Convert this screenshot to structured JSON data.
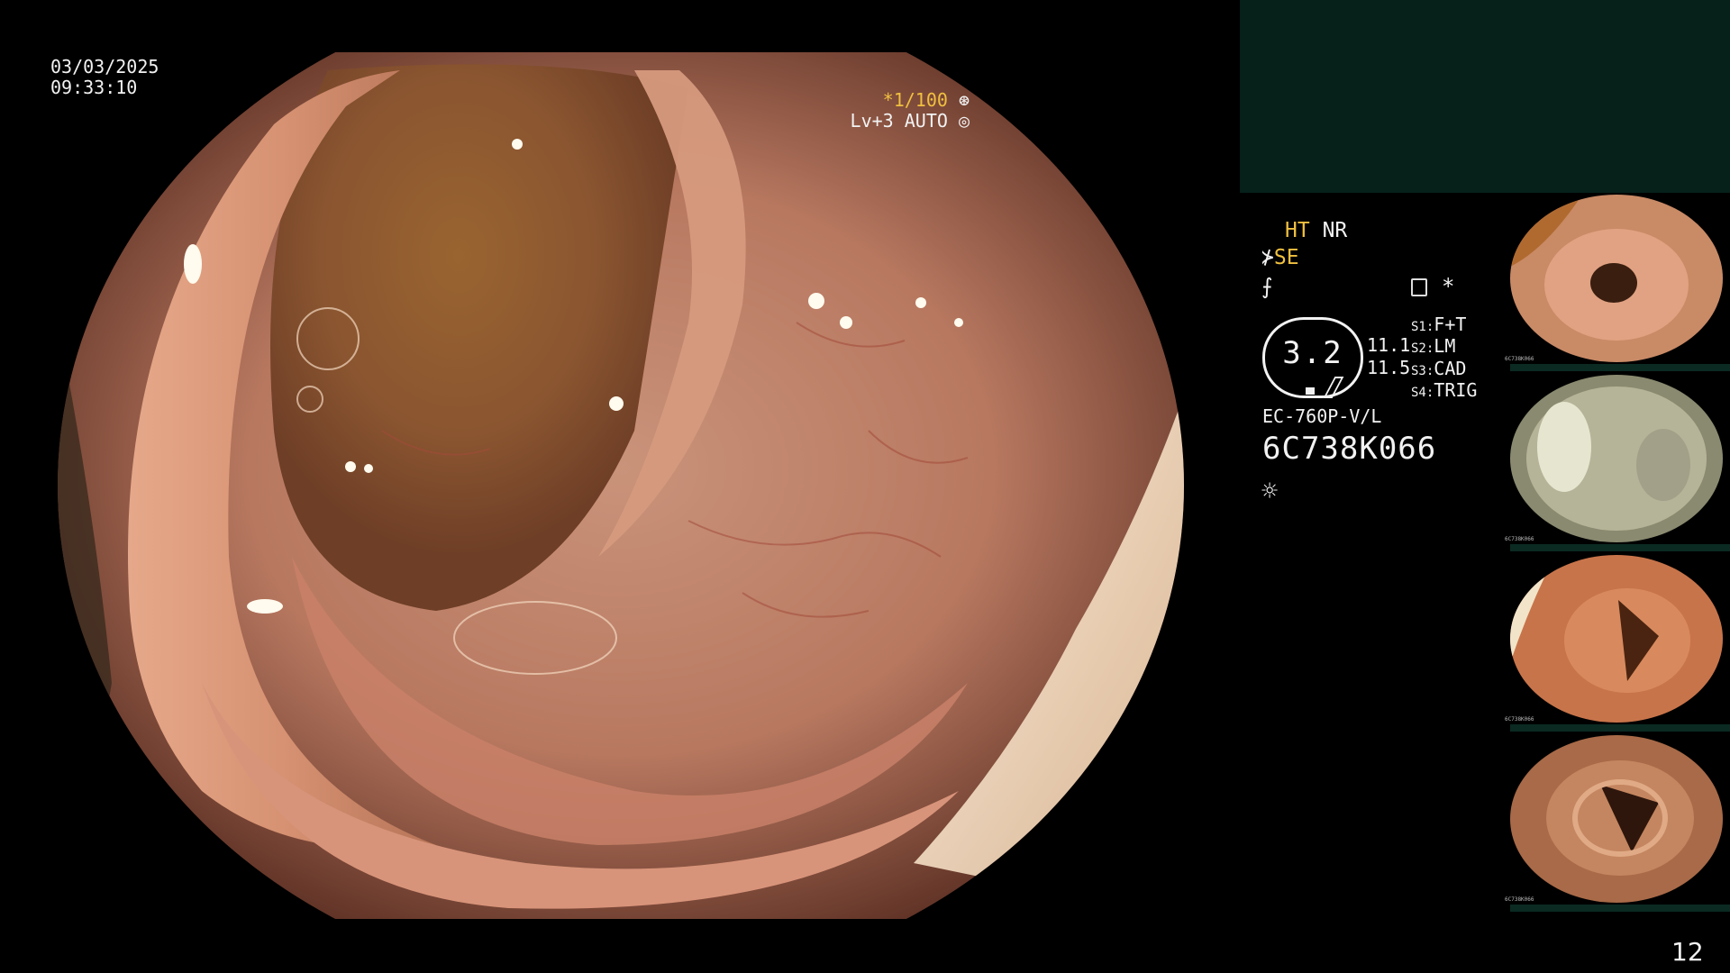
{
  "overlay": {
    "date": "03/03/2025",
    "time": "09:33:10",
    "shutter_speed": "*1/100",
    "level_mode": "Lv+3 AUTO"
  },
  "panel": {
    "mode_ht": "HT",
    "mode_nr": "NR",
    "mode_se": "SE",
    "star": "*",
    "zoom_value": "3.2",
    "zoom_top": "11.1",
    "zoom_bottom": "11.5",
    "switches": [
      {
        "key": "S1",
        "value": "F+T"
      },
      {
        "key": "S2",
        "value": "LM"
      },
      {
        "key": "S3",
        "value": "CAD"
      },
      {
        "key": "S4",
        "value": "TRIG"
      }
    ],
    "scope_model": "EC-760P-V/L",
    "scope_serial": "6C738K066"
  },
  "thumbnails": [
    {
      "label": "6C738K066"
    },
    {
      "label": "6C738K066"
    },
    {
      "label": "6C738K066"
    },
    {
      "label": "6C738K066"
    }
  ],
  "page_number": "12",
  "colors": {
    "overlay_yellow": "#f0c040",
    "panel_teal": "#06201a",
    "mucosa": "#c98a6e"
  },
  "icons": [
    "iris-icon",
    "light-icon",
    "keyboard-icon",
    "brightness-icon",
    "scope-icon",
    "freeze-icon"
  ]
}
